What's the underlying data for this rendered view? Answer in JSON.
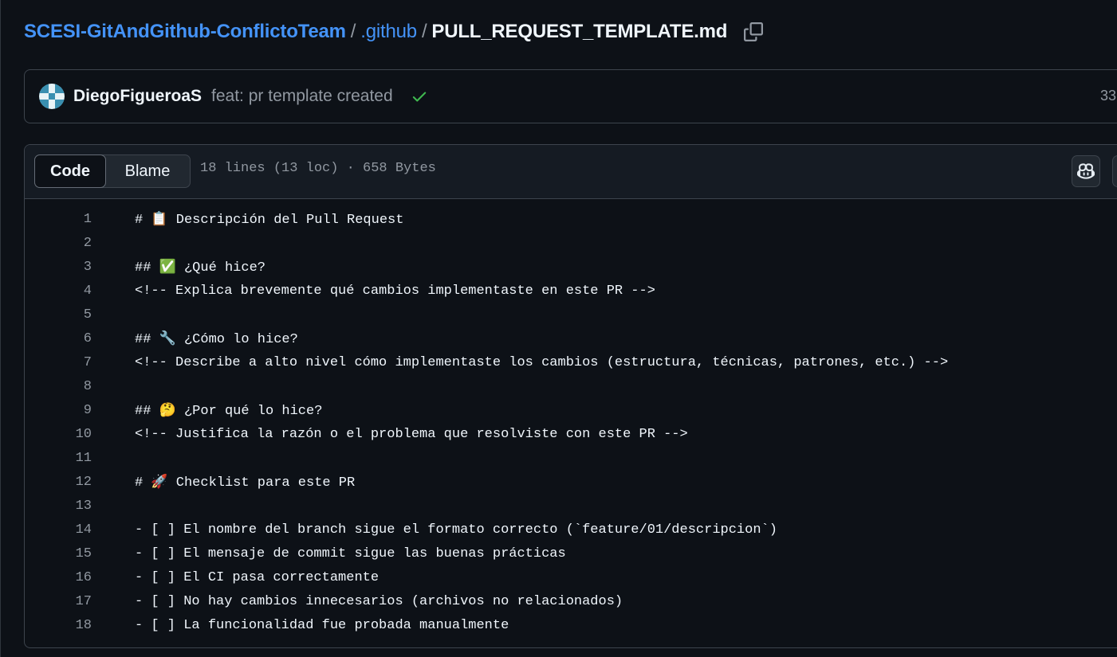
{
  "breadcrumb": {
    "repo": "SCESI-GitAndGithub-ConflictoTeam",
    "separator": "/",
    "folder": ".github",
    "file": "PULL_REQUEST_TEMPLATE.md"
  },
  "commit": {
    "author": "DiegoFigueroaS",
    "message": "feat: pr template created",
    "hash_partial": "33",
    "status_icon": "check-icon",
    "status_color": "#3fb950"
  },
  "file_header": {
    "tabs": [
      "Code",
      "Blame"
    ],
    "active_tab": "Code",
    "info": "18 lines (13 loc) · 658 Bytes"
  },
  "code_lines": [
    {
      "num": "1",
      "text": "# 📋 Descripción del Pull Request"
    },
    {
      "num": "2",
      "text": ""
    },
    {
      "num": "3",
      "text": "## ✅ ¿Qué hice?"
    },
    {
      "num": "4",
      "text": "<!-- Explica brevemente qué cambios implementaste en este PR -->"
    },
    {
      "num": "5",
      "text": ""
    },
    {
      "num": "6",
      "text": "## 🔧 ¿Cómo lo hice?"
    },
    {
      "num": "7",
      "text": "<!-- Describe a alto nivel cómo implementaste los cambios (estructura, técnicas, patrones, etc.) -->"
    },
    {
      "num": "8",
      "text": ""
    },
    {
      "num": "9",
      "text": "## 🤔 ¿Por qué lo hice?"
    },
    {
      "num": "10",
      "text": "<!-- Justifica la razón o el problema que resolviste con este PR -->"
    },
    {
      "num": "11",
      "text": ""
    },
    {
      "num": "12",
      "text": "# 🚀 Checklist para este PR"
    },
    {
      "num": "13",
      "text": ""
    },
    {
      "num": "14",
      "text": "- [ ] El nombre del branch sigue el formato correcto (`feature/01/descripcion`)"
    },
    {
      "num": "15",
      "text": "- [ ] El mensaje de commit sigue las buenas prácticas"
    },
    {
      "num": "16",
      "text": "- [ ] El CI pasa correctamente"
    },
    {
      "num": "17",
      "text": "- [ ] No hay cambios innecesarios (archivos no relacionados)"
    },
    {
      "num": "18",
      "text": "- [ ] La funcionalidad fue probada manualmente"
    }
  ],
  "colors": {
    "background": "#0d1117",
    "link": "#4493f8",
    "border": "#3d444d",
    "muted": "#9198a1"
  }
}
